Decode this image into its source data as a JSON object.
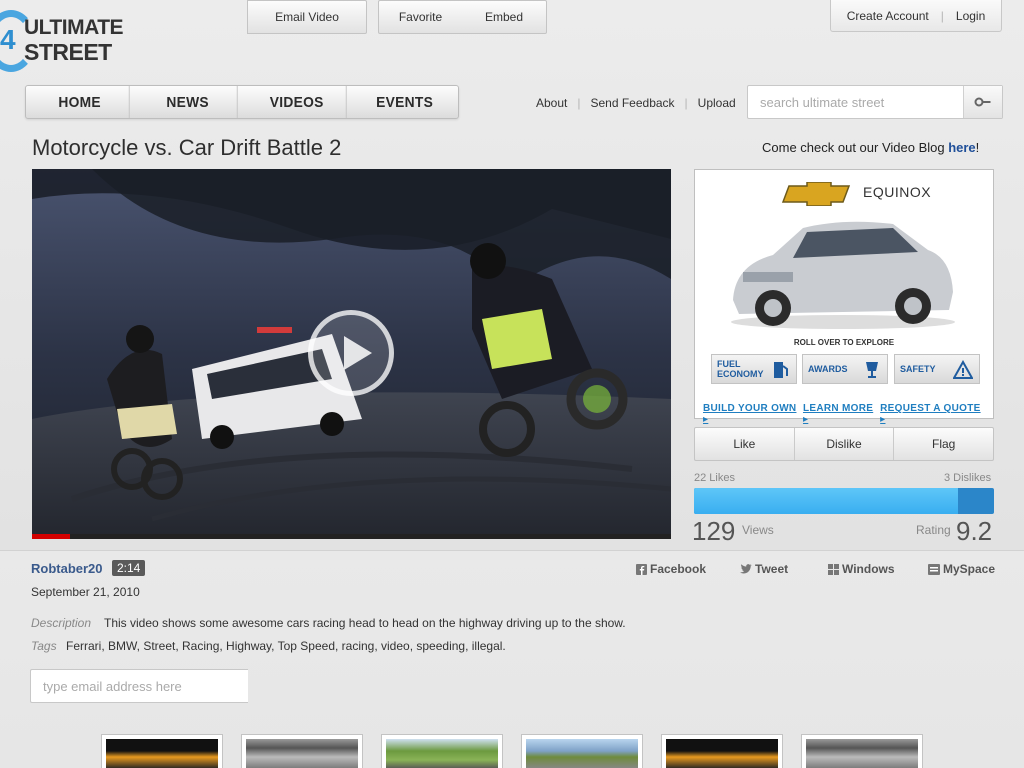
{
  "logo": {
    "line1": "ULTIMATE",
    "line2": "STREET"
  },
  "account": {
    "create_label": "Create Account",
    "login_label": "Login"
  },
  "nav": {
    "items": [
      "HOME",
      "NEWS",
      "VIDEOS",
      "EVENTS"
    ]
  },
  "subnav": {
    "about": "About",
    "feedback": "Send Feedback",
    "upload": "Upload"
  },
  "search": {
    "placeholder": "search ultimate street",
    "icon": "search-key-icon"
  },
  "video": {
    "title": "Motorcycle vs. Car Drift Battle 2",
    "progress_fraction": 0.06,
    "play_icon": "play-icon"
  },
  "blog_promo": {
    "text": "Come check out our Video Blog ",
    "link": "here",
    "suffix": "!"
  },
  "ad": {
    "brand": "EQUINOX",
    "roll_text": "ROLL OVER TO EXPLORE",
    "chips": [
      {
        "line1": "FUEL",
        "line2": "ECONOMY",
        "icon": "fuel-pump-icon"
      },
      {
        "line1": "AWARDS",
        "line2": "",
        "icon": "trophy-icon"
      },
      {
        "line1": "SAFETY",
        "line2": "",
        "icon": "warning-triangle-icon"
      }
    ],
    "links": [
      "BUILD YOUR OWN ▸",
      "LEARN MORE ▸",
      "REQUEST A QUOTE ▸"
    ]
  },
  "actions": {
    "like": "Like",
    "dislike": "Dislike",
    "flag": "Flag"
  },
  "stats": {
    "likes_text": "22 Likes",
    "dislikes_text": "3 Dislikes",
    "like_fraction": 0.88,
    "views": "129",
    "views_label": "Views",
    "rating_label": "Rating",
    "rating": "9.2"
  },
  "meta": {
    "uploader": "Robtaber20",
    "duration": "2:14",
    "date": "September 21, 2010",
    "description_label": "Description",
    "description": "This video shows some awesome cars racing head to head on the highway driving up to the show.",
    "tags_label": "Tags",
    "tags": "Ferrari, BMW, Street, Racing, Highway, Top Speed, racing, video, speeding, illegal."
  },
  "share": {
    "facebook": "Facebook",
    "tweet": "Tweet",
    "windows": "Windows",
    "myspace": "MySpace"
  },
  "email": {
    "placeholder": "type email address here",
    "button": "Email Video"
  },
  "buttons": {
    "favorite": "Favorite",
    "embed": "Embed"
  },
  "colors": {
    "accent_blue": "#39aef0",
    "progress_red": "#d20000",
    "link_blue": "#1f4f99"
  }
}
